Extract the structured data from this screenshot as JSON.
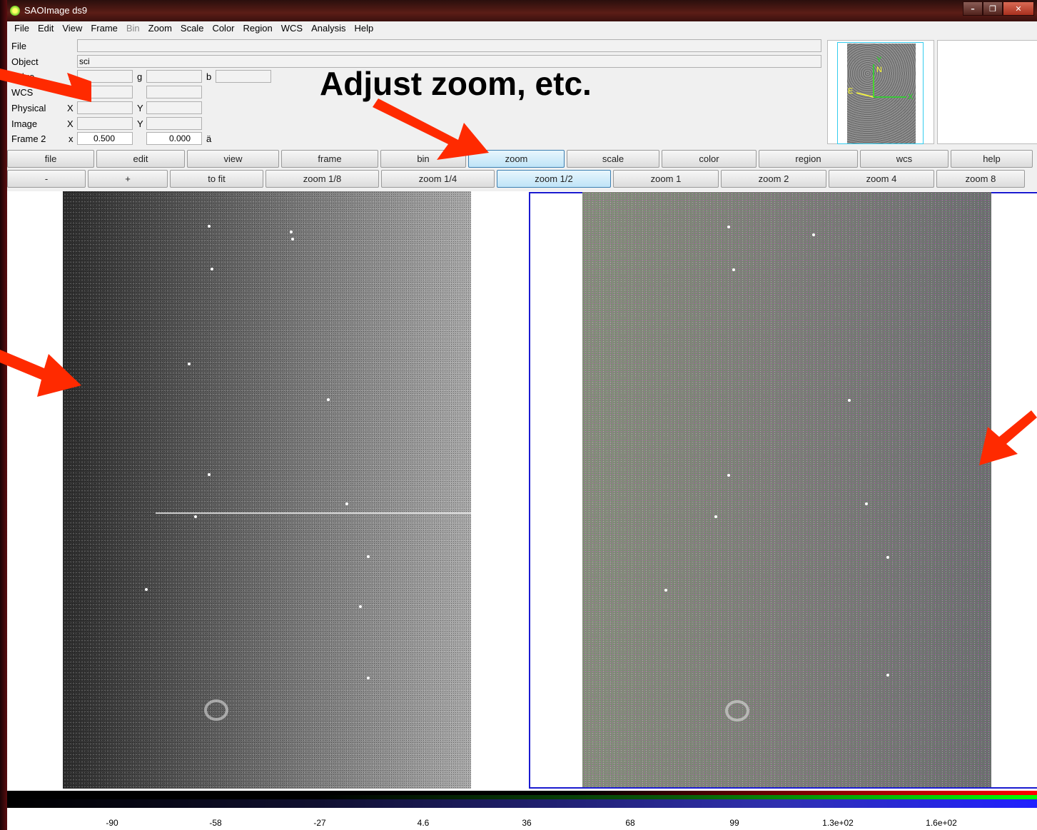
{
  "window": {
    "title": "SAOImage ds9",
    "minimize": "–",
    "maximize": "❐",
    "close": "✕"
  },
  "menubar": [
    "File",
    "Edit",
    "View",
    "Frame",
    "Bin",
    "Zoom",
    "Scale",
    "Color",
    "Region",
    "WCS",
    "Analysis",
    "Help"
  ],
  "info": {
    "file_label": "File",
    "file_value": "",
    "object_label": "Object",
    "object_value": "sci",
    "value_label": "Value",
    "r_label": "r",
    "g_label": "g",
    "b_label": "b",
    "wcs_label": "WCS",
    "physical_label": "Physical",
    "physical_x_label": "X",
    "physical_y_label": "Y",
    "image_label": "Image",
    "image_x_label": "X",
    "image_y_label": "Y",
    "frame_label": "Frame 2",
    "frame_x_label": "x",
    "frame_zoom": "0.500",
    "frame_angle": "0.000",
    "frame_angle_unit": "ä"
  },
  "panner": {
    "north": "N",
    "east": "E",
    "x_axis": "X",
    "y_axis": "Y"
  },
  "buttonbar_main": [
    "file",
    "edit",
    "view",
    "frame",
    "bin",
    "zoom",
    "scale",
    "color",
    "region",
    "wcs",
    "help"
  ],
  "buttonbar_main_active": "zoom",
  "buttonbar_zoom": [
    "-",
    "+",
    "to fit",
    "zoom 1/8",
    "zoom 1/4",
    "zoom 1/2",
    "zoom 1",
    "zoom 2",
    "zoom 4",
    "zoom 8"
  ],
  "buttonbar_zoom_active": "zoom 1/2",
  "colorbar_ticks": [
    "-90",
    "-58",
    "-27",
    "4.6",
    "36",
    "68",
    "99",
    "1.3e+02",
    "1.6e+02"
  ],
  "annotation": {
    "text": "Adjust zoom, etc.",
    "arrow_color": "#ff2a00"
  },
  "colors": {
    "active_button": "#bfe4f7",
    "frame_highlight": "#1a1ad0",
    "title_bar": "#5b1d16"
  }
}
